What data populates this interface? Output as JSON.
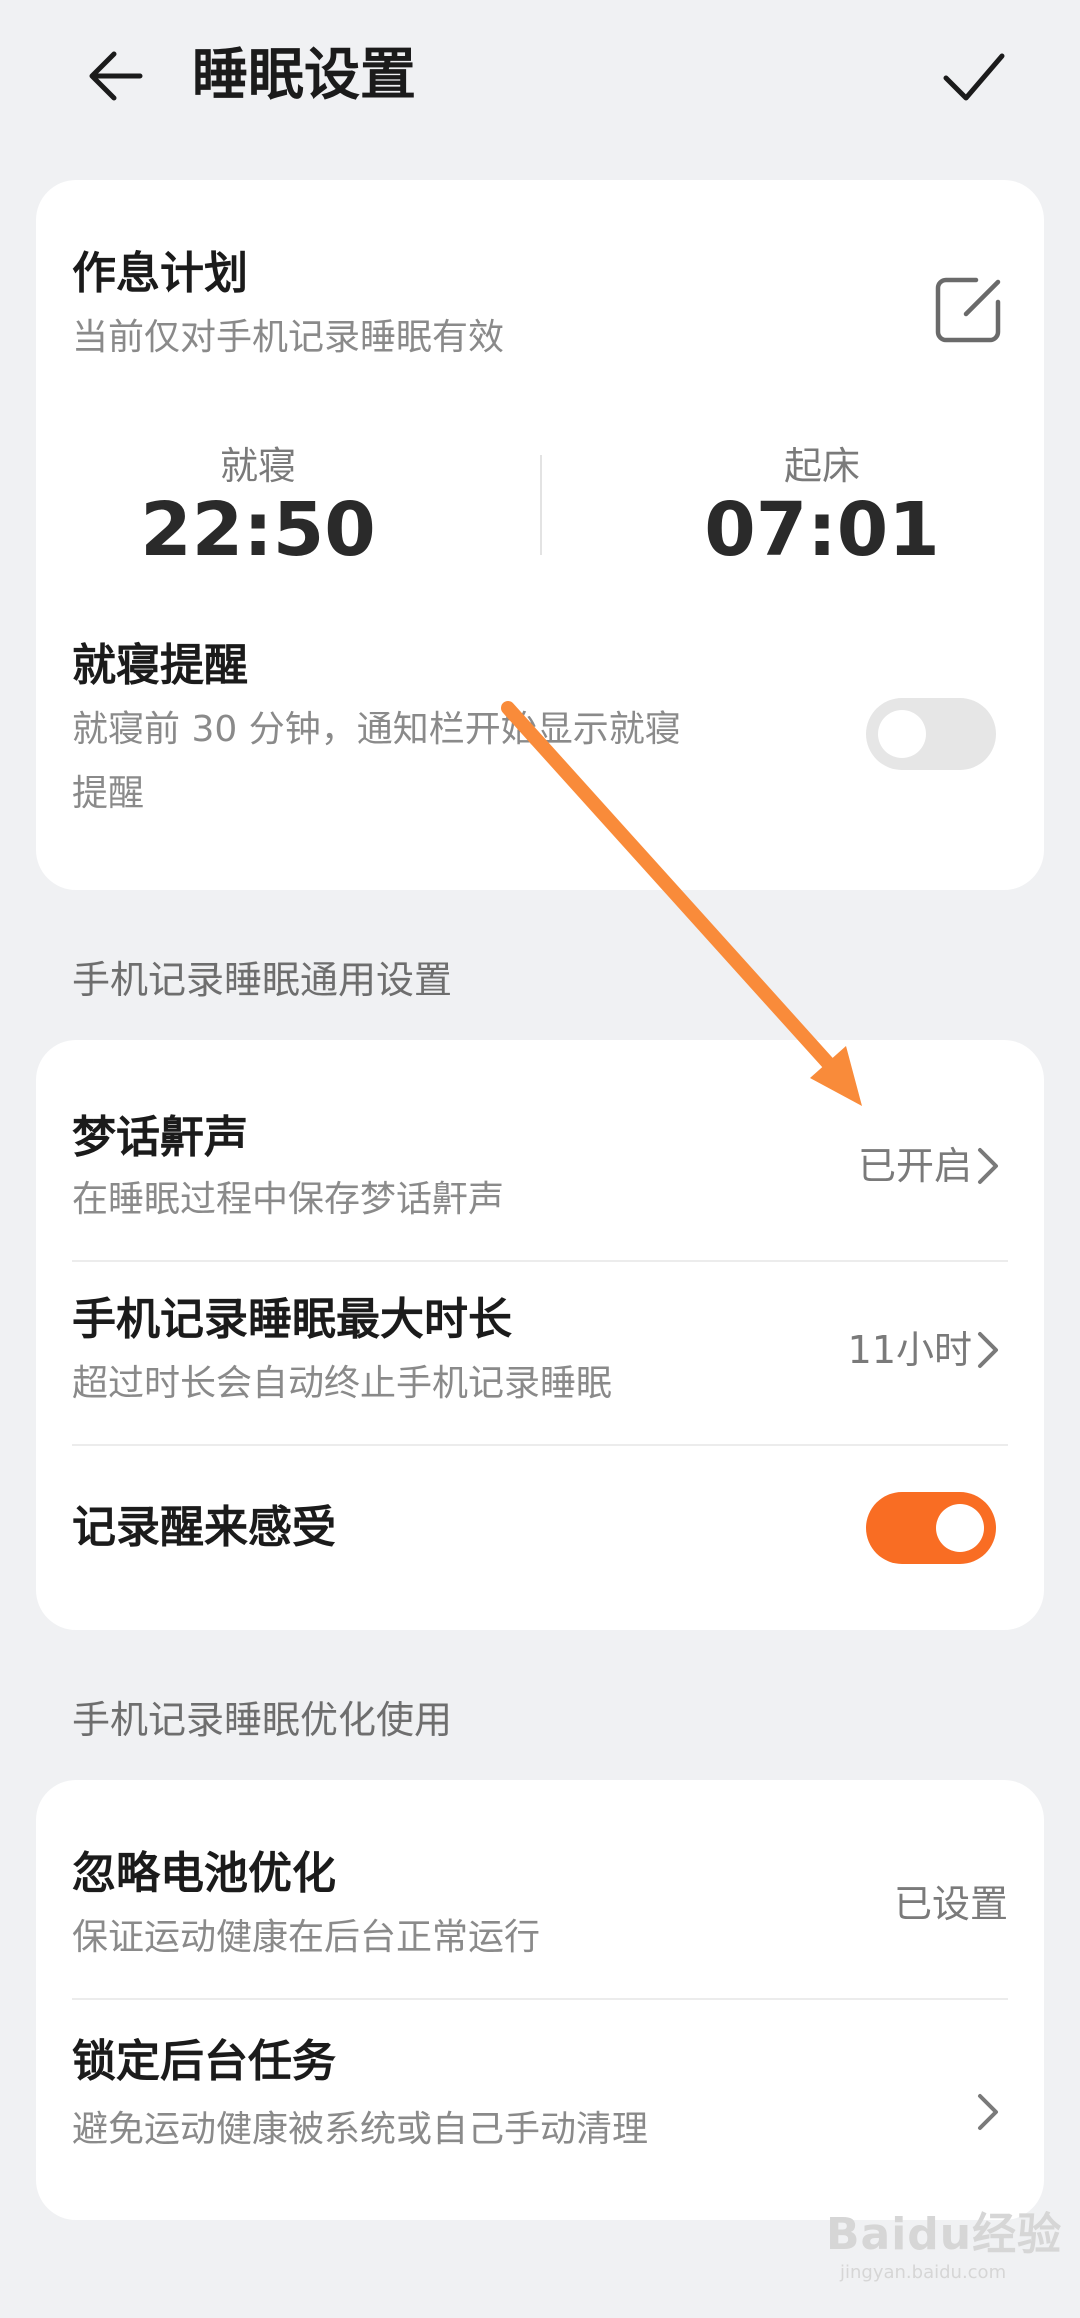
{
  "header": {
    "title": "睡眠设置"
  },
  "schedule": {
    "title": "作息计划",
    "subtitle": "当前仅对手机记录睡眠有效",
    "bedtime_label": "就寝",
    "bedtime_value": "22:50",
    "wake_label": "起床",
    "wake_value": "07:01",
    "reminder_title": "就寝提醒",
    "reminder_desc_line1": "就寝前 30 分钟，通知栏开始显示就寝",
    "reminder_desc_line2": "提醒",
    "reminder_enabled": false
  },
  "general": {
    "section_title": "手机记录睡眠通用设置",
    "items": [
      {
        "title": "梦话鼾声",
        "desc": "在睡眠过程中保存梦话鼾声",
        "value": "已开启"
      },
      {
        "title": "手机记录睡眠最大时长",
        "desc": "超过时长会自动终止手机记录睡眠",
        "value": "11小时"
      },
      {
        "title": "记录醒来感受",
        "enabled": true
      }
    ]
  },
  "optimize": {
    "section_title": "手机记录睡眠优化使用",
    "items": [
      {
        "title": "忽略电池优化",
        "desc": "保证运动健康在后台正常运行",
        "value": "已设置"
      },
      {
        "title": "锁定后台任务",
        "desc": "避免运动健康被系统或自己手动清理"
      }
    ]
  },
  "colors": {
    "accent": "#f96d23",
    "annotation_arrow": "#f98b3a",
    "background": "#f0f1f3"
  },
  "watermark": {
    "text": "Baidu经验",
    "sub": "jingyan.baidu.com"
  }
}
